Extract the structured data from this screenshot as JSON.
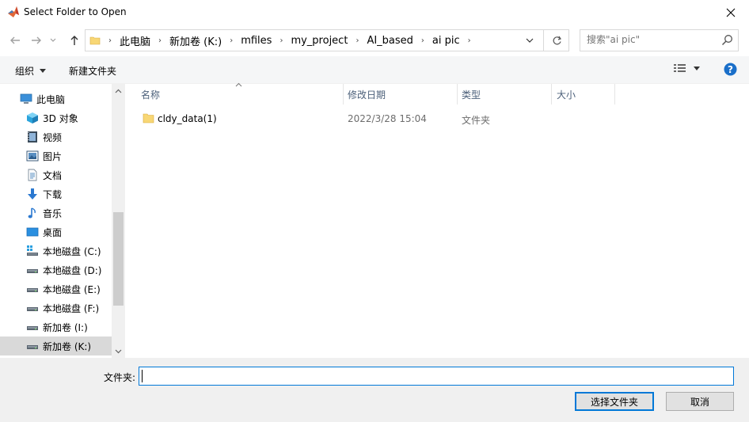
{
  "window": {
    "title": "Select Folder to Open"
  },
  "address": {
    "crumbs": [
      "此电脑",
      "新加卷 (K:)",
      "mfiles",
      "my_project",
      "AI_based",
      "ai pic"
    ]
  },
  "search": {
    "placeholder": "搜索\"ai pic\""
  },
  "toolbar": {
    "organize": "组织",
    "new_folder": "新建文件夹"
  },
  "nav": {
    "items": [
      {
        "label": "此电脑",
        "icon": "computer-icon"
      },
      {
        "label": "3D 对象",
        "icon": "3d-objects-icon"
      },
      {
        "label": "视频",
        "icon": "video-icon"
      },
      {
        "label": "图片",
        "icon": "pictures-icon"
      },
      {
        "label": "文档",
        "icon": "documents-icon"
      },
      {
        "label": "下载",
        "icon": "download-icon"
      },
      {
        "label": "音乐",
        "icon": "music-icon"
      },
      {
        "label": "桌面",
        "icon": "desktop-icon"
      },
      {
        "label": "本地磁盘 (C:)",
        "icon": "drive-icon"
      },
      {
        "label": "本地磁盘 (D:)",
        "icon": "drive-icon"
      },
      {
        "label": "本地磁盘 (E:)",
        "icon": "drive-icon"
      },
      {
        "label": "本地磁盘 (F:)",
        "icon": "drive-icon"
      },
      {
        "label": "新加卷 (I:)",
        "icon": "drive-icon"
      },
      {
        "label": "新加卷 (K:)",
        "icon": "drive-icon",
        "selected": true
      }
    ]
  },
  "list": {
    "columns": [
      "名称",
      "修改日期",
      "类型",
      "大小"
    ],
    "rows": [
      {
        "name": "cldy_data(1)",
        "date": "2022/3/28 15:04",
        "type": "文件夹",
        "size": ""
      }
    ]
  },
  "bottom": {
    "folder_label": "文件夹:",
    "folder_value": "",
    "select_button": "选择文件夹",
    "cancel_button": "取消"
  },
  "colors": {
    "accent": "#0078d7",
    "selected_bg": "#d9d9d9",
    "folder": "#f8d775",
    "help": "#1a6fc9"
  }
}
